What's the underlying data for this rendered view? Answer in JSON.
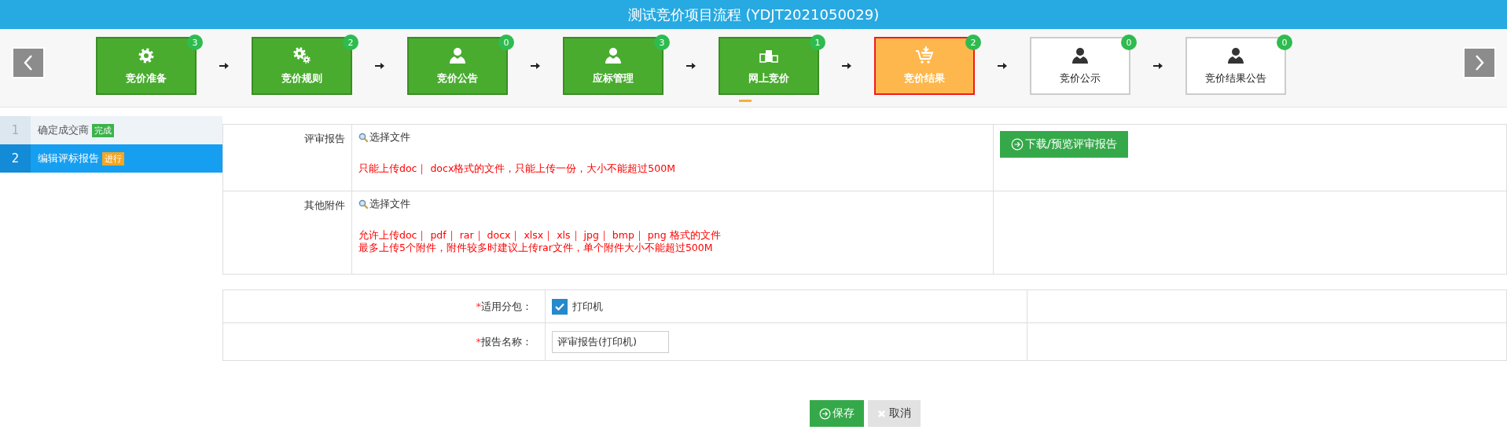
{
  "header": {
    "title": "测试竞价项目流程 (YDJT2021050029)"
  },
  "steps": [
    {
      "label": "竞价准备",
      "count": "3",
      "kind": "done",
      "selected": false
    },
    {
      "label": "竞价规则",
      "count": "2",
      "kind": "done",
      "selected": false
    },
    {
      "label": "竞价公告",
      "count": "0",
      "kind": "done",
      "selected": false
    },
    {
      "label": "应标管理",
      "count": "3",
      "kind": "done",
      "selected": false
    },
    {
      "label": "网上竞价",
      "count": "1",
      "kind": "done",
      "selected": true
    },
    {
      "label": "竞价结果",
      "count": "2",
      "kind": "current",
      "selected": false
    },
    {
      "label": "竞价公示",
      "count": "0",
      "kind": "pending",
      "selected": false
    },
    {
      "label": "竞价结果公告",
      "count": "0",
      "kind": "pending",
      "selected": false
    }
  ],
  "substeps": [
    {
      "number": "1",
      "label": "确定成交商",
      "badge": {
        "text": "完成",
        "color": "#3cb34a"
      },
      "selected": false
    },
    {
      "number": "2",
      "label": "编辑评标报告",
      "badge": {
        "text": "进行",
        "color": "#f5a623"
      },
      "selected": true
    }
  ],
  "attachments": [
    {
      "label": "评审报告",
      "picker": "选择文件",
      "hints": [
        "只能上传doc｜ docx格式的文件，只能上传一份，大小不能超过500M"
      ],
      "action": "下载/预览评审报告"
    },
    {
      "label": "其他附件",
      "picker": "选择文件",
      "hints": [
        "允许上传doc｜ pdf｜ rar｜ docx｜ xlsx｜ xls｜ jpg｜ bmp｜ png 格式的文件",
        "最多上传5个附件，附件较多时建议上传rar文件，单个附件大小不能超过500M"
      ]
    }
  ],
  "form": [
    {
      "kind": "checkbox",
      "required_mark": "*",
      "label": "适用分包：",
      "option": "打印机",
      "checked": true
    },
    {
      "kind": "text",
      "required_mark": "*",
      "label": "报告名称：",
      "value": "评审报告(打印机)"
    }
  ],
  "buttons": [
    {
      "kind": "primary",
      "label": "保存"
    },
    {
      "kind": "secondary",
      "label": "取消"
    }
  ]
}
